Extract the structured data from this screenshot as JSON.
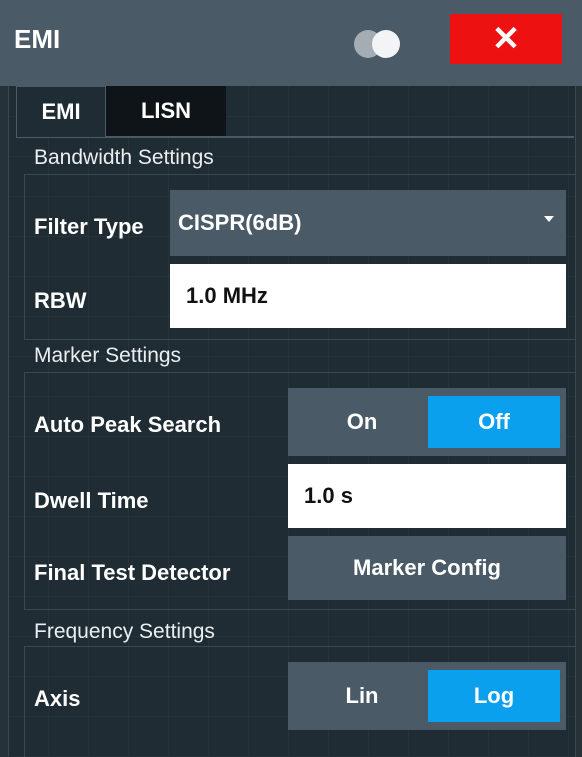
{
  "window": {
    "title": "EMI",
    "close_symbol": "✕"
  },
  "tabs": [
    {
      "label": "EMI",
      "active": true
    },
    {
      "label": "LISN",
      "active": false
    }
  ],
  "bandwidth": {
    "section_title": "Bandwidth Settings",
    "filter_type_label": "Filter Type",
    "filter_type_value": "CISPR(6dB)",
    "rbw_label": "RBW",
    "rbw_value": "1.0 MHz"
  },
  "marker": {
    "section_title": "Marker Settings",
    "auto_peak_label": "Auto Peak Search",
    "auto_peak_on": "On",
    "auto_peak_off": "Off",
    "auto_peak_selected": "Off",
    "dwell_label": "Dwell Time",
    "dwell_value": "1.0 s",
    "final_test_label": "Final Test Detector",
    "marker_config_button": "Marker Config"
  },
  "frequency": {
    "section_title": "Frequency Settings",
    "axis_label": "Axis",
    "axis_lin": "Lin",
    "axis_log": "Log",
    "axis_selected": "Log"
  },
  "colors": {
    "accent": "#0aa0ee",
    "close": "#ee1111",
    "background": "#1f2c33",
    "control": "#4a5a66"
  }
}
